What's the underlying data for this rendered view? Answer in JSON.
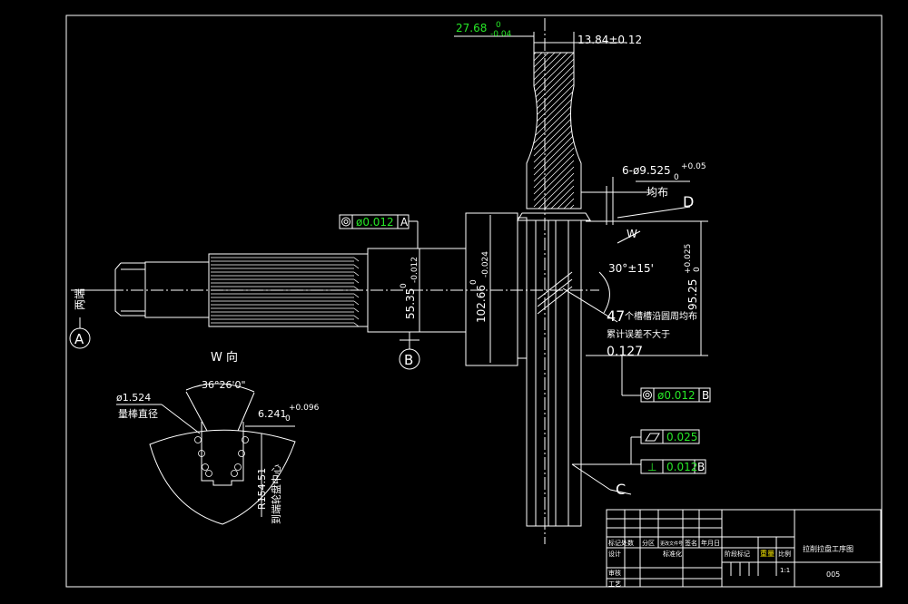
{
  "dimensions": {
    "flange_thickness": {
      "base": "27.68",
      "upper": "0",
      "lower": "-0.04"
    },
    "web_width": "13.84±0.12",
    "bolt_holes": {
      "base": "6-ø9.525",
      "upper": "+0.05",
      "lower": "0"
    },
    "bolt_holes_note": "均布",
    "dia_55": {
      "base": "55.35",
      "upper": "0",
      "lower": "-0.012"
    },
    "dia_102": {
      "base": "102.66",
      "upper": "0",
      "lower": "-0.024"
    },
    "dia_95": {
      "base": "95.25",
      "upper": "+0.025",
      "lower": "0"
    },
    "angle": "30°±15'",
    "spline_count": "47",
    "spline_note": "个槽槽沿圆周均布",
    "cumulative_note": "累计误差不大于",
    "cumulative_value": "0.127"
  },
  "labels": {
    "both_ends": "两端",
    "datum_a": "A",
    "datum_b": "B",
    "datum_c": "C",
    "datum_d": "D",
    "view_arrow": "W",
    "view_title": "W 向"
  },
  "tolerance_frames": {
    "concentricity_a": {
      "value": "ø0.012",
      "datum": "A"
    },
    "concentricity_b": {
      "value": "ø0.012",
      "datum": "B"
    },
    "flatness": {
      "value": "0.025"
    },
    "perpendicularity": {
      "value": "0.012",
      "datum": "B"
    }
  },
  "detail_view": {
    "angle": "36°26'0\"",
    "pin_dia": "ø1.524",
    "pin_label": "量棒直径",
    "size": {
      "base": "6.241",
      "upper": "+0.096",
      "lower": "0"
    },
    "radius": "R154.51",
    "radius_note": "到端轮盘中心"
  },
  "title_block": {
    "title": "拉削拉盘工序图",
    "code": "005",
    "rev_mark": "标记处数",
    "zone": "分区",
    "doc_no": "更改文件号",
    "sign": "签名",
    "date": "年月日",
    "designer": "设计",
    "standard": "标准化",
    "stage_mark": "阶段标记",
    "weight": "重量",
    "scale": "比例",
    "scale_value": "1:1",
    "review": "审核",
    "process": "工艺"
  },
  "colors": {
    "frame": "#ffffff",
    "dimension_green": "#27e627",
    "tb_yellow": "#ffee00"
  }
}
